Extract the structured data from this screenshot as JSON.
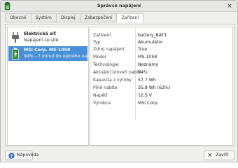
{
  "window": {
    "title": "Správce napájení"
  },
  "tabs": [
    {
      "label": "Obecné"
    },
    {
      "label": "Systém"
    },
    {
      "label": "Displej"
    },
    {
      "label": "Zabezpečení"
    },
    {
      "label": "Zařízení"
    }
  ],
  "active_tab": "Zařízení",
  "devices": [
    {
      "name": "Elektrická síť",
      "sub": "Napájení ze sítě",
      "icon": "power-plug-icon",
      "selected": false
    },
    {
      "name": "MSI Corp. MS-1058",
      "sub": "94% - 7 minut do úplného nabití",
      "icon": "battery-icon",
      "selected": true
    }
  ],
  "properties": [
    {
      "key": "Zařízení",
      "value": "battery_BAT1"
    },
    {
      "key": "Typ",
      "value": "Akumulátor"
    },
    {
      "key": "Zdroj napájení",
      "value": "True"
    },
    {
      "key": "Model",
      "value": "MS-1058"
    },
    {
      "key": "Technologie",
      "value": "Neznámý"
    },
    {
      "key": "Aktuální úroveň nabití",
      "value": "94%"
    },
    {
      "key": "Kapacita z výroby",
      "value": "57,7 Wh"
    },
    {
      "key": "Plně nabito",
      "value": "35,8 Wh (62%)"
    },
    {
      "key": "Napětí",
      "value": "12,5 V"
    },
    {
      "key": "Výrobce",
      "value": "MSI Corp."
    }
  ],
  "footer": {
    "help_label": "Nápověda",
    "close_label": "Zavřít"
  },
  "colors": {
    "selection": "#4a90d9",
    "battery": "#3aa03a"
  }
}
